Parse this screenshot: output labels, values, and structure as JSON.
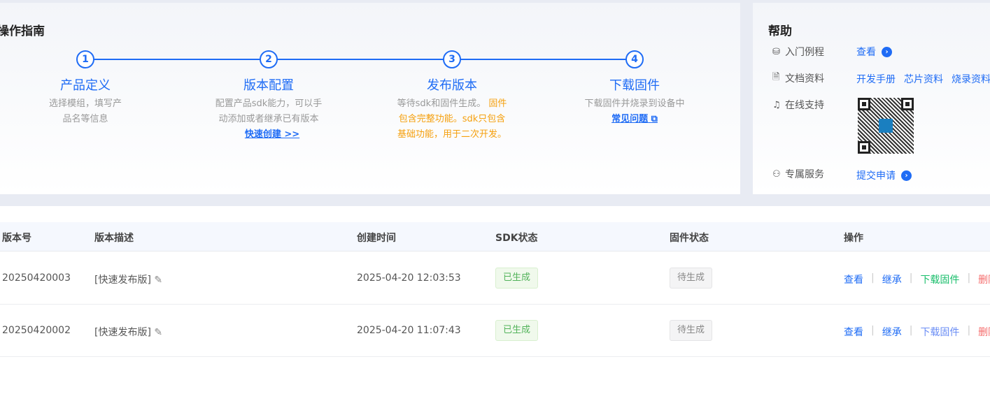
{
  "guide": {
    "title": "操作指南",
    "steps": [
      {
        "num": "1",
        "title": "产品定义",
        "desc": "选择模组，填写产品名等信息"
      },
      {
        "num": "2",
        "title": "版本配置",
        "desc": "配置产品sdk能力，可以手动添加或者继承已有版本",
        "link": "快速创建 >>"
      },
      {
        "num": "3",
        "title": "发布版本",
        "desc": "等待sdk和固件生成。",
        "desc_highlight": "固件包含完整功能。sdk只包含基础功能，用于二次开发。"
      },
      {
        "num": "4",
        "title": "下载固件",
        "desc": "下载固件并烧录到设备中",
        "link": "常见问题"
      }
    ]
  },
  "help": {
    "title": "帮助",
    "items": [
      {
        "label": "入门例程",
        "icon": "tutorial-icon",
        "links": [
          "查看"
        ]
      },
      {
        "label": "文档资料",
        "icon": "document-icon",
        "links": [
          "开发手册",
          "芯片资料",
          "烧录资料"
        ]
      },
      {
        "label": "在线支持",
        "icon": "headset-icon"
      },
      {
        "label": "专属服务",
        "icon": "medal-icon",
        "links": [
          "提交申请"
        ]
      }
    ]
  },
  "table": {
    "headers": [
      "版本号",
      "版本描述",
      "创建时间",
      "SDK状态",
      "固件状态",
      "操作"
    ],
    "rows": [
      {
        "version": "20250420003",
        "desc": "[快速发布版]",
        "time": "2025-04-20 12:03:53",
        "sdk": "已生成",
        "fw": "待生成",
        "ops": [
          "查看",
          "继承",
          "下载固件",
          "删除"
        ]
      },
      {
        "version": "20250420002",
        "desc": "[快速发布版]",
        "time": "2025-04-20 11:07:43",
        "sdk": "已生成",
        "fw": "待生成",
        "ops": [
          "查看",
          "继承",
          "下载固件",
          "删除"
        ]
      }
    ]
  },
  "colors": {
    "accent": "#1f6cf5",
    "orange": "#f5a00e",
    "green": "#19be6b",
    "danger": "#f56c6c"
  }
}
